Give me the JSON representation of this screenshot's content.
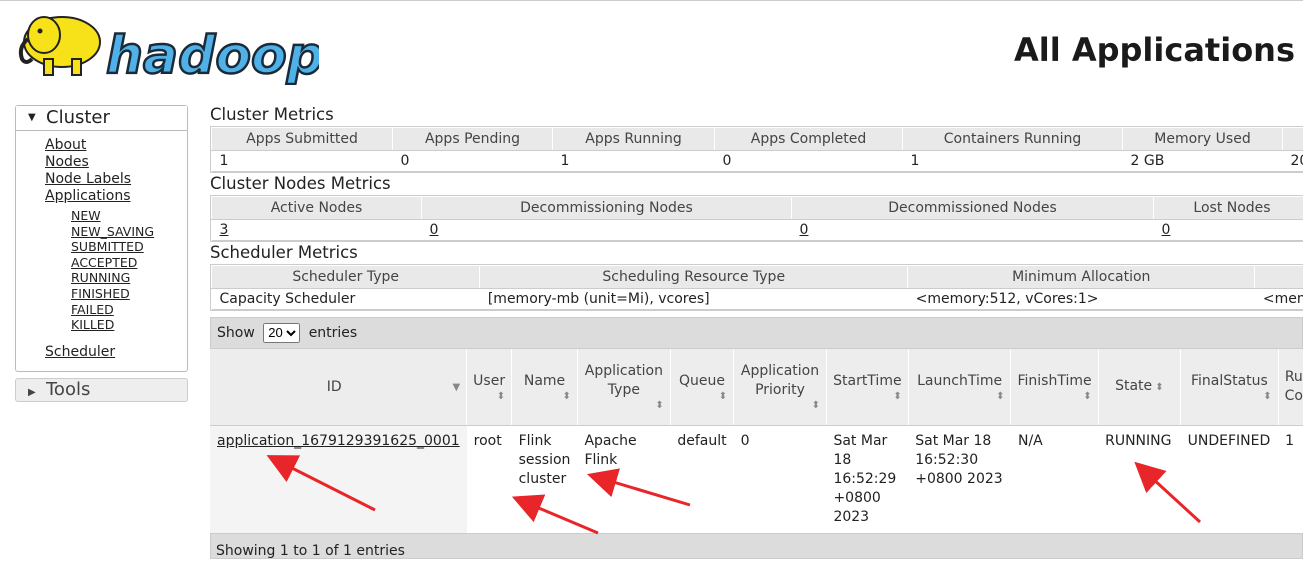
{
  "header": {
    "logo_text": "hadoop",
    "title": "All Applications"
  },
  "sidebar": {
    "cluster_label": "Cluster",
    "items": [
      "About",
      "Nodes",
      "Node Labels",
      "Applications"
    ],
    "app_states": [
      "NEW",
      "NEW_SAVING",
      "SUBMITTED",
      "ACCEPTED",
      "RUNNING",
      "FINISHED",
      "FAILED",
      "KILLED"
    ],
    "scheduler_label": "Scheduler",
    "tools_label": "Tools"
  },
  "cluster_metrics": {
    "title": "Cluster Metrics",
    "headers": [
      "Apps Submitted",
      "Apps Pending",
      "Apps Running",
      "Apps Completed",
      "Containers Running",
      "Memory Used",
      ""
    ],
    "values": [
      "1",
      "0",
      "1",
      "0",
      "1",
      "2 GB",
      "20"
    ]
  },
  "nodes_metrics": {
    "title": "Cluster Nodes Metrics",
    "headers": [
      "Active Nodes",
      "Decommissioning Nodes",
      "Decommissioned Nodes",
      "Lost Nodes"
    ],
    "values": [
      "3",
      "0",
      "0",
      "0"
    ]
  },
  "scheduler_metrics": {
    "title": "Scheduler Metrics",
    "headers": [
      "Scheduler Type",
      "Scheduling Resource Type",
      "Minimum Allocation",
      ""
    ],
    "values": [
      "Capacity Scheduler",
      "[memory-mb (unit=Mi), vcores]",
      "<memory:512, vCores:1>",
      "<mem"
    ]
  },
  "apps_table": {
    "show_label": "Show",
    "entries_label": "entries",
    "page_size": "20",
    "headers": [
      "ID",
      "User",
      "Name",
      "Application Type",
      "Queue",
      "Application Priority",
      "StartTime",
      "LaunchTime",
      "FinishTime",
      "State",
      "FinalStatus",
      "Ru Co"
    ],
    "row": {
      "id": "application_1679129391625_0001",
      "user": "root",
      "name": "Flink session cluster",
      "type": "Apache Flink",
      "queue": "default",
      "priority": "0",
      "start": "Sat Mar 18 16:52:29 +0800 2023",
      "launch": "Sat Mar 18 16:52:30 +0800 2023",
      "finish": "N/A",
      "state": "RUNNING",
      "final_status": "UNDEFINED",
      "running": "1"
    },
    "footer": "Showing 1 to 1 of 1 entries"
  },
  "colors": {
    "annotation_arrow": "#e8262a",
    "logo_yellow": "#f7e21a",
    "logo_blue": "#4fb1e8"
  }
}
